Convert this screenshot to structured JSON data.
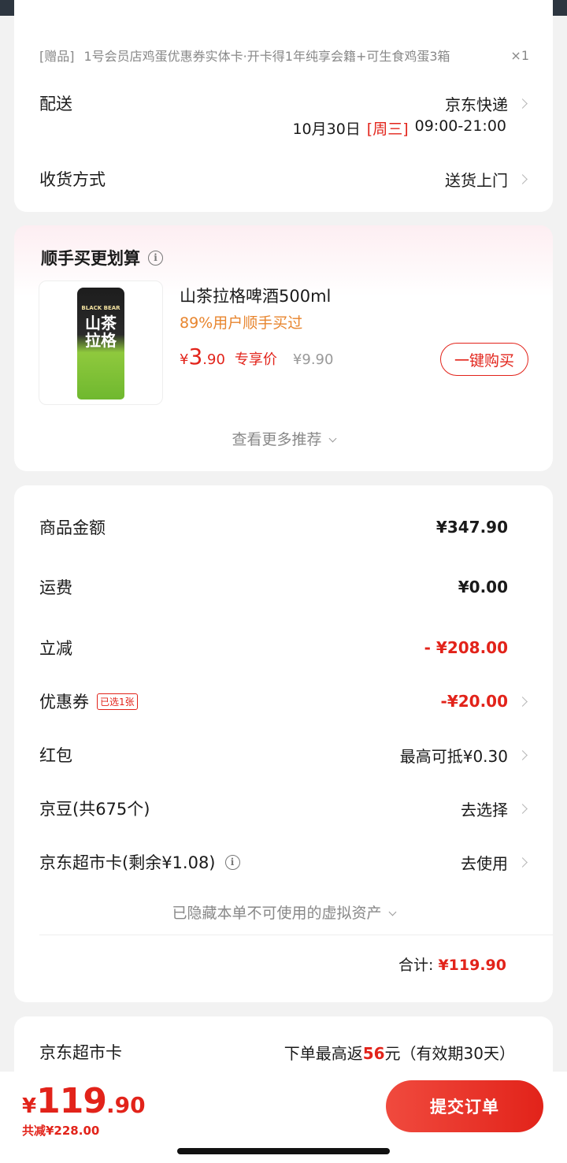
{
  "gift": {
    "tag": "[赠品]",
    "text": "1号会员店鸡蛋优惠券实体卡·开卡得1年纯享会籍+可生食鸡蛋3箱",
    "qty": "×1"
  },
  "delivery": {
    "label": "配送",
    "carrier": "京东快递",
    "date": "10月30日",
    "weekday": "[周三]",
    "time": "09:00-21:00",
    "method_label": "收货方式",
    "method_value": "送货上门"
  },
  "recommend": {
    "title": "顺手买更划算",
    "product": {
      "name": "山茶拉格啤酒500ml",
      "social": "89%用户顺手买过",
      "currency": "¥",
      "price_int": "3",
      "price_dec": ".90",
      "exclusive_label": "专享价",
      "orig_price": "¥9.90",
      "buy_label": "一键购买",
      "can_brand": "BLACK BEAR",
      "can_title": "山茶拉格"
    },
    "more_label": "查看更多推荐"
  },
  "summary": {
    "goods_label": "商品金额",
    "goods_value": "¥347.90",
    "shipping_label": "运费",
    "shipping_value": "¥0.00",
    "discount_label": "立减",
    "discount_value": "- ¥208.00",
    "coupon_label": "优惠券",
    "coupon_badge": "已选1张",
    "coupon_value": "-¥20.00",
    "redpacket_label": "红包",
    "redpacket_value": "最高可抵¥0.30",
    "beans_label": "京豆(共675个)",
    "beans_value": "去选择",
    "card_label": "京东超市卡(剩余¥1.08)",
    "card_value": "去使用",
    "hidden_note": "已隐藏本单不可使用的虚拟资产",
    "total_label": "合计:",
    "total_value": "¥119.90"
  },
  "supermarket": {
    "label": "京东超市卡",
    "text_pre": "下单最高返",
    "amount": "56",
    "text_post": "元（有效期30天）"
  },
  "footer": {
    "currency": "¥",
    "price_int": "119",
    "price_dec": ".90",
    "saved": "共减¥228.00",
    "submit_label": "提交订单"
  },
  "colors": {
    "accent": "#e2231a",
    "orange": "#e8852e",
    "background": "#f2f2f2"
  }
}
